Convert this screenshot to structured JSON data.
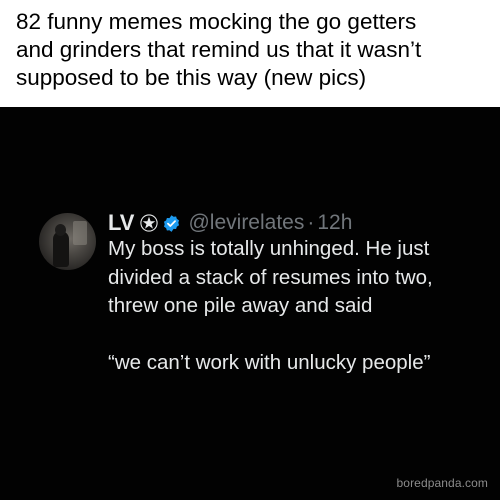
{
  "caption": {
    "lines": [
      "82 funny memes mocking the go getters",
      "and grinders that remind us that it wasn’t",
      "supposed to be this way (new pics)"
    ]
  },
  "tweet": {
    "display_name": "LV",
    "handle": "@levirelates",
    "separator": "·",
    "time": "12h",
    "star_icon": "star-icon",
    "verified_icon": "verified-badge-icon",
    "verified_color": "#1d9bf0",
    "text_lines": [
      "My boss is totally unhinged. He just",
      "divided a stack of resumes into two,",
      "threw one pile away and said"
    ],
    "quote_line": "“we can’t work with unlucky people”"
  },
  "watermark": "boredpanda.com"
}
